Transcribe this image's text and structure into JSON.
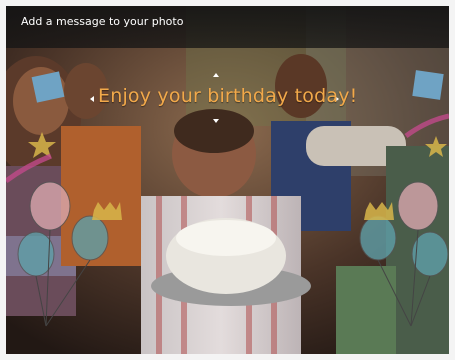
{
  "message_bar": {
    "title": "Add a message to your photo"
  },
  "caption": {
    "text": "Enjoy your birthday today!",
    "color": "#f2a94a"
  },
  "handles": {
    "up": "arrow-up-icon",
    "down": "arrow-down-icon",
    "left": "arrow-left-icon",
    "right": "arrow-right-icon"
  },
  "colors": {
    "bar_background": "#1a1a1a",
    "frame_background": "#f4f4f4",
    "balloon_pink": "#d9a6ad",
    "balloon_teal": "#5f9fa8"
  }
}
